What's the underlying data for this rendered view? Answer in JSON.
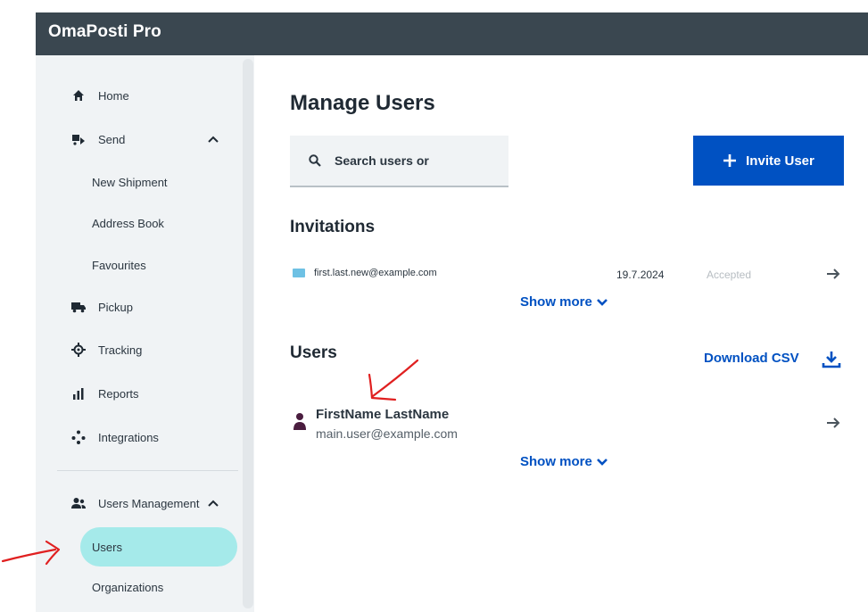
{
  "app": {
    "title": "OmaPosti Pro"
  },
  "sidebar": {
    "items": [
      {
        "label": "Home",
        "icon": "home-icon"
      },
      {
        "label": "Send",
        "icon": "send-icon",
        "expanded": true
      },
      {
        "label": "New Shipment"
      },
      {
        "label": "Address Book"
      },
      {
        "label": "Favourites"
      },
      {
        "label": "Pickup",
        "icon": "truck-icon"
      },
      {
        "label": "Tracking",
        "icon": "crosshair-icon"
      },
      {
        "label": "Reports",
        "icon": "bar-chart-icon"
      },
      {
        "label": "Integrations",
        "icon": "integrations-icon"
      },
      {
        "label": "Users Management",
        "icon": "users-icon",
        "expanded": true
      },
      {
        "label": "Users",
        "active": true
      },
      {
        "label": "Organizations"
      }
    ]
  },
  "main": {
    "title": "Manage Users",
    "search": {
      "placeholder": "Search users or"
    },
    "invite_button": "Invite User",
    "invitations": {
      "title": "Invitations",
      "rows": [
        {
          "email": "first.last.new@example.com",
          "date": "19.7.2024",
          "status": "Accepted"
        }
      ],
      "show_more": "Show more"
    },
    "users": {
      "title": "Users",
      "download_csv": "Download CSV",
      "rows": [
        {
          "name": "FirstName LastName",
          "email": "main.user@example.com"
        }
      ],
      "show_more": "Show more"
    }
  },
  "colors": {
    "topbar": "#3a4750",
    "accent": "#0051c2",
    "active_pill": "#a5eaea",
    "annotation": "#e02020",
    "user_icon": "#4a1d3f"
  }
}
